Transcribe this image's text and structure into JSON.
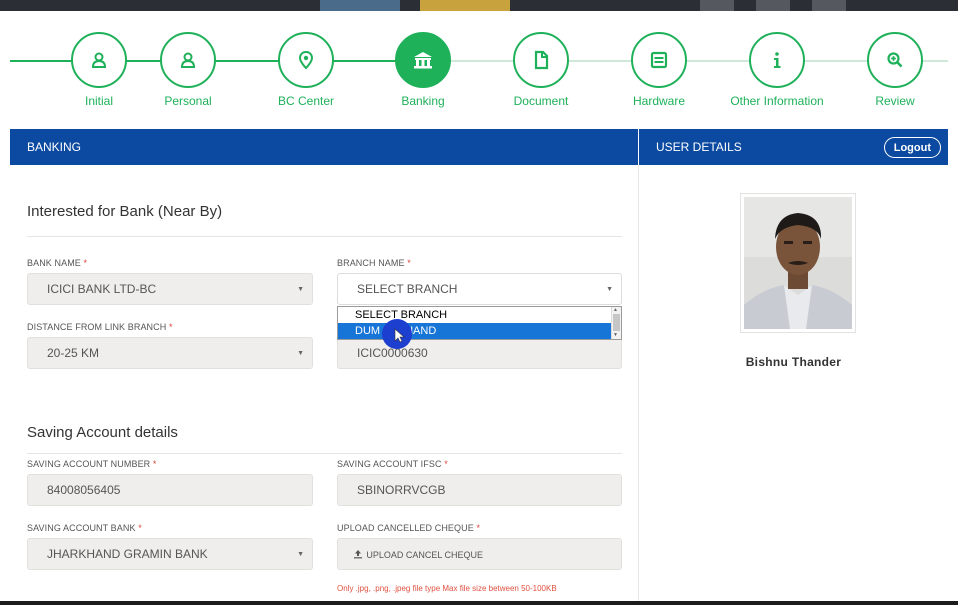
{
  "steps": [
    {
      "label": "Initial",
      "icon": "user-icon"
    },
    {
      "label": "Personal",
      "icon": "user-icon"
    },
    {
      "label": "BC Center",
      "icon": "location-pin-icon"
    },
    {
      "label": "Banking",
      "icon": "bank-icon",
      "active": true
    },
    {
      "label": "Document",
      "icon": "document-icon"
    },
    {
      "label": "Hardware",
      "icon": "hardware-icon"
    },
    {
      "label": "Other Information",
      "icon": "info-icon"
    },
    {
      "label": "Review",
      "icon": "zoom-in-icon"
    }
  ],
  "banking": {
    "header": "BANKING",
    "section1_title": "Interested for Bank (Near By)",
    "bank_name_label": "BANK NAME",
    "bank_name_value": "ICICI BANK LTD-BC",
    "branch_name_label": "BRANCH NAME",
    "branch_name_value": "SELECT BRANCH",
    "branch_options": [
      "SELECT BRANCH",
      "DUMKA JHARKHAND"
    ],
    "branch_option_visible_2": "DUM     ARKHAND",
    "distance_label": "DISTANCE FROM LINK BRANCH",
    "distance_value": "20-25 KM",
    "ifsc_value": "ICIC0000630",
    "section2_title": "Saving Account details",
    "saving_acc_no_label": "SAVING ACCOUNT NUMBER",
    "saving_acc_no_value": "84008056405",
    "saving_ifsc_label": "SAVING ACCOUNT IFSC",
    "saving_ifsc_value": "SBINORRVCGB",
    "saving_bank_label": "SAVING ACCOUNT BANK",
    "saving_bank_value": "JHARKHAND GRAMIN BANK",
    "upload_label": "UPLOAD CANCELLED CHEQUE",
    "upload_button": "UPLOAD CANCEL CHEQUE",
    "upload_note": "Only .jpg, .png, .jpeg file type Max file size between 50-100KB",
    "required_mark": "*"
  },
  "user": {
    "header": "USER DETAILS",
    "logout": "Logout",
    "name": "Bishnu Thander"
  },
  "colors": {
    "accent_green": "#1fb15a",
    "header_blue": "#0b4aa0",
    "required_red": "#d9443b",
    "selection_blue": "#1875d8"
  }
}
